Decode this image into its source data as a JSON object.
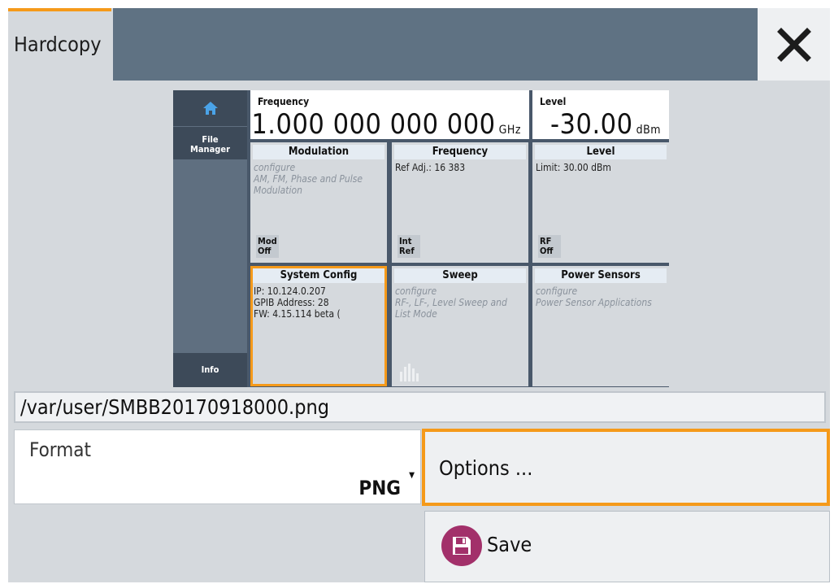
{
  "dialog": {
    "title": "Hardcopy",
    "close_icon": "close-icon"
  },
  "preview": {
    "sidebar": {
      "home_icon": "home-icon",
      "file_manager": "File\nManager",
      "info": "Info"
    },
    "frequency": {
      "label": "Frequency",
      "value": "1.000 000 000 000",
      "unit": "GHz"
    },
    "level": {
      "label": "Level",
      "value": "-30.00",
      "unit": "dBm"
    },
    "tiles": [
      {
        "title": "Modulation",
        "text": "configure\nAM, FM, Phase and Pulse\nModulation",
        "faded": true,
        "tag": "Mod\nOff"
      },
      {
        "title": "Frequency",
        "text": "Ref Adj.: 16 383",
        "faded": false,
        "tag": "Int\nRef"
      },
      {
        "title": "Level",
        "text": "Limit: 30.00 dBm",
        "faded": false,
        "tag": "RF\nOff"
      },
      {
        "title": "System Config",
        "text": "IP: 10.124.0.207\nGPIB Address: 28\nFW: 4.15.114 beta (",
        "faded": false,
        "tag": ""
      },
      {
        "title": "Sweep",
        "text": "configure\nRF-, LF-, Level Sweep and\nList Mode",
        "faded": true,
        "tag": ""
      },
      {
        "title": "Power Sensors",
        "text": "configure\nPower Sensor Applications",
        "faded": true,
        "tag": ""
      }
    ]
  },
  "file_path": "/var/user/SMBB20170918000.png",
  "format": {
    "label": "Format",
    "value": "PNG"
  },
  "buttons": {
    "options": "Options ...",
    "save": "Save",
    "save_icon": "floppy-disk-icon"
  },
  "colors": {
    "accent": "#f59a1a",
    "title_bar": "#5f7283",
    "save_icon_bg": "#a2306a"
  }
}
